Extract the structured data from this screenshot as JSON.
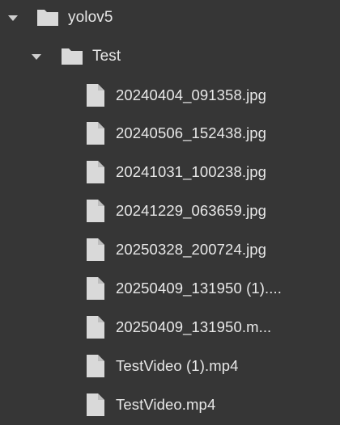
{
  "file_tree": {
    "root_folder": {
      "name": "yolov5",
      "icon": "folder-icon",
      "expanded": true,
      "children": {
        "test_folder": {
          "name": "Test",
          "icon": "folder-icon",
          "expanded": true
        }
      }
    },
    "files": [
      {
        "name": "20240404_091358.jpg",
        "icon": "file-icon"
      },
      {
        "name": "20240506_152438.jpg",
        "icon": "file-icon"
      },
      {
        "name": "20241031_100238.jpg",
        "icon": "file-icon"
      },
      {
        "name": "20241229_063659.jpg",
        "icon": "file-icon"
      },
      {
        "name": "20250328_200724.jpg",
        "icon": "file-icon"
      },
      {
        "name": "20250409_131950 (1)....",
        "icon": "file-icon"
      },
      {
        "name": "20250409_131950.m...",
        "icon": "file-icon"
      },
      {
        "name": "TestVideo (1).mp4",
        "icon": "file-icon"
      },
      {
        "name": "TestVideo.mp4",
        "icon": "file-icon"
      }
    ]
  },
  "colors": {
    "background": "#363636",
    "icon_fill": "#d9d9d9",
    "text": "#e8e8e8"
  }
}
